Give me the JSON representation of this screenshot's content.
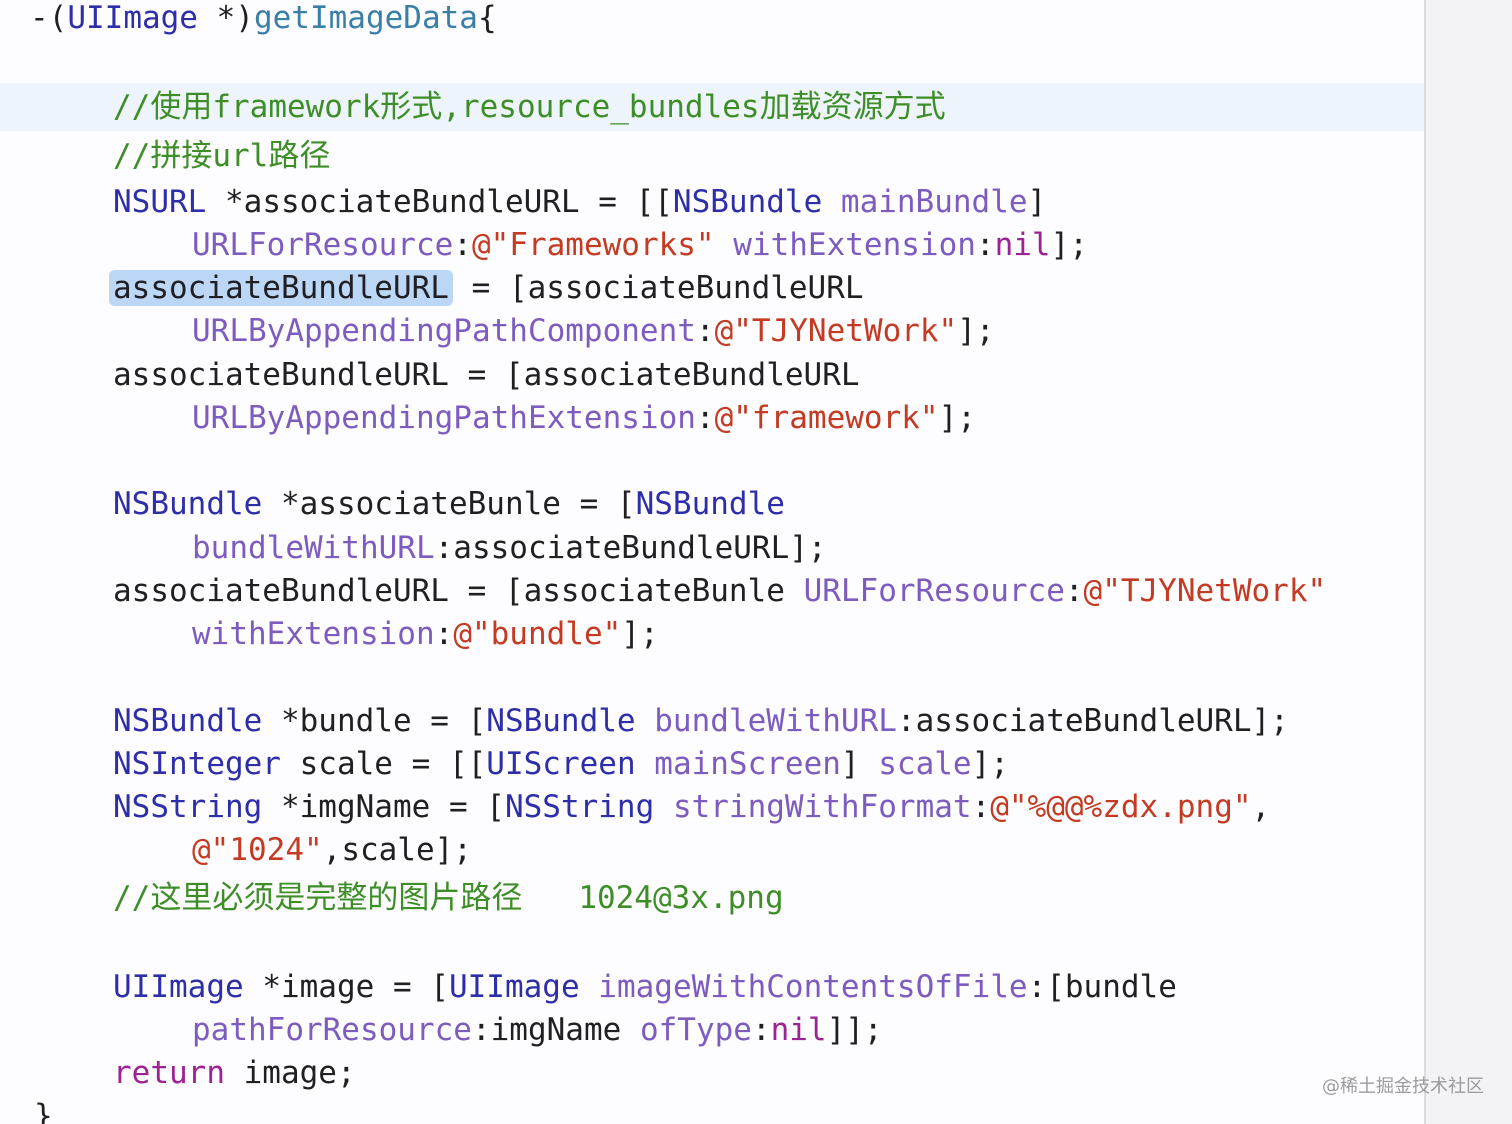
{
  "editor": {
    "lines": {
      "l1": {
        "a": "-(",
        "b": "UIImage",
        "c": " *)",
        "d": "getImageData",
        "e": "{"
      },
      "l2": {
        "a": "//使用framework形式,resource_bundles加载资源方式"
      },
      "l3": {
        "a": "//拼接url路径"
      },
      "l4": {
        "a": "NSURL",
        "b": " *associateBundleURL = [[",
        "c": "NSBundle",
        "d": " ",
        "e": "mainBundle",
        "f": "]"
      },
      "l5": {
        "a": "URLForResource",
        "b": ":",
        "c": "@\"Frameworks\"",
        "d": " ",
        "e": "withExtension",
        "f": ":",
        "g": "nil",
        "h": "];"
      },
      "l6": {
        "a": "associateBundleURL",
        "b": " = [associateBundleURL"
      },
      "l7": {
        "a": "URLByAppendingPathComponent",
        "b": ":",
        "c": "@\"TJYNetWork\"",
        "d": "];"
      },
      "l8": {
        "a": "associateBundleURL = [associateBundleURL"
      },
      "l9": {
        "a": "URLByAppendingPathExtension",
        "b": ":",
        "c": "@\"framework\"",
        "d": "];"
      },
      "l10": {
        "a": "NSBundle",
        "b": " *associateBunle = [",
        "c": "NSBundle"
      },
      "l11": {
        "a": "bundleWithURL",
        "b": ":associateBundleURL];"
      },
      "l12": {
        "a": "associateBundleURL = [associateBunle ",
        "b": "URLForResource",
        "c": ":",
        "d": "@\"TJYNetWork\""
      },
      "l13": {
        "a": "withExtension",
        "b": ":",
        "c": "@\"bundle\"",
        "d": "];"
      },
      "l14": {
        "a": "NSBundle",
        "b": " *bundle = [",
        "c": "NSBundle",
        "d": " ",
        "e": "bundleWithURL",
        "f": ":associateBundleURL];"
      },
      "l15": {
        "a": "NSInteger",
        "b": " scale = [[",
        "c": "UIScreen",
        "d": " ",
        "e": "mainScreen",
        "f": "] ",
        "g": "scale",
        "h": "];"
      },
      "l16": {
        "a": "NSString",
        "b": " *imgName = [",
        "c": "NSString",
        "d": " ",
        "e": "stringWithFormat",
        "f": ":",
        "g": "@\"%@@%zdx.png\"",
        "h": ","
      },
      "l17": {
        "a": "@\"1024\"",
        "b": ",scale];"
      },
      "l18": {
        "a": "//这里必须是完整的图片路径   1024@3x.png"
      },
      "l19": {
        "a": "UIImage",
        "b": " *image = [",
        "c": "UIImage",
        "d": " ",
        "e": "imageWithContentsOfFile",
        "f": ":[bundle"
      },
      "l20": {
        "a": "pathForResource",
        "b": ":imgName ",
        "c": "ofType",
        "d": ":",
        "e": "nil",
        "f": "]];"
      },
      "l21": {
        "a": "return",
        "b": " image;"
      },
      "l22": {
        "a": "}"
      }
    }
  },
  "watermark": "@稀土掘金技术社区"
}
